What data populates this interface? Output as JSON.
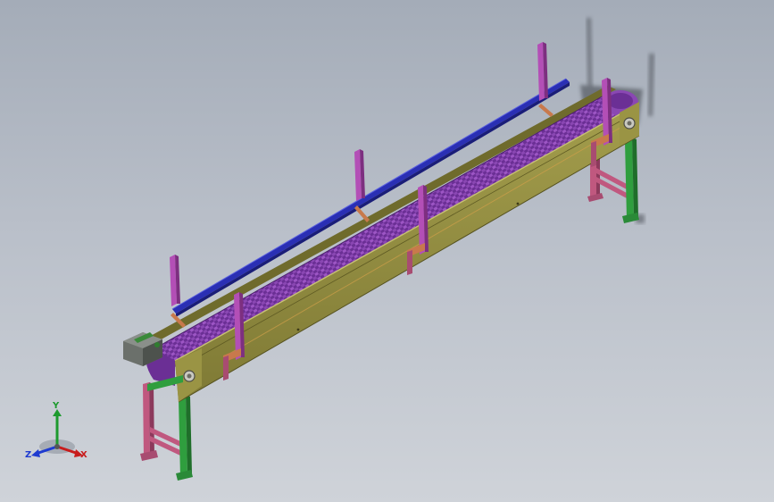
{
  "triad": {
    "x_label": "X",
    "y_label": "Y",
    "z_label": "Z"
  },
  "colors": {
    "background_top": "#a4acb8",
    "background_bottom": "#cfd3d9",
    "frame": "#8f8a3e",
    "belt": "#7a3aa8",
    "guide_rail": "#2a2fb4",
    "bracket": "#b34fb6",
    "leg_green": "#2f9e3e",
    "leg_pink": "#c0587f",
    "motor": "#5f6460",
    "x_axis": "#c81c1c",
    "y_axis": "#1d9a2e",
    "z_axis": "#1e3bd0"
  },
  "icons": [
    "coordinate-triad-icon"
  ]
}
